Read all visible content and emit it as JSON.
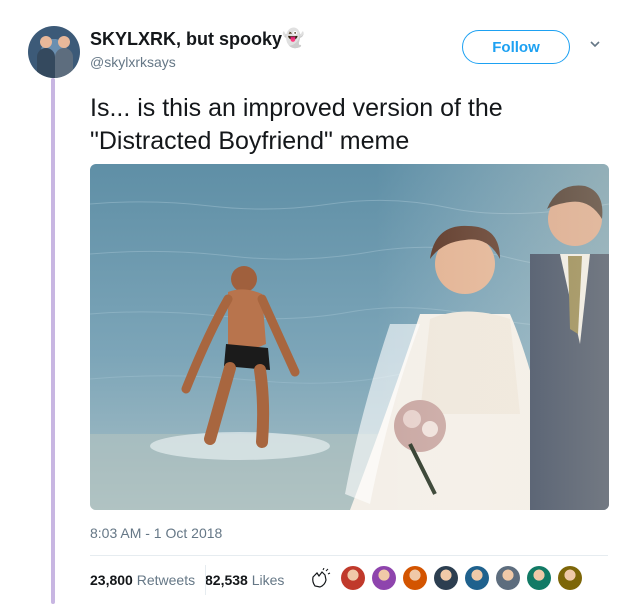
{
  "user": {
    "display_name": "SKYLXRK, but spooky",
    "emoji": "👻",
    "handle": "@skylxrksays"
  },
  "actions": {
    "follow_label": "Follow"
  },
  "tweet": {
    "text": "Is... is this an improved version of the \"Distracted Boyfriend\" meme",
    "timestamp": "8:03 AM - 1 Oct 2018"
  },
  "stats": {
    "retweets_count": "23,800",
    "retweets_label": "Retweets",
    "likes_count": "82,538",
    "likes_label": "Likes"
  },
  "liker_colors": [
    "#c0392b",
    "#8e44ad",
    "#d35400",
    "#2c3e50",
    "#1f618d",
    "#5d6d7e",
    "#117a65",
    "#7d6608"
  ],
  "colors": {
    "accent": "#1da1f2",
    "thread_line": "#c8b6e2",
    "muted_text": "#657786"
  }
}
